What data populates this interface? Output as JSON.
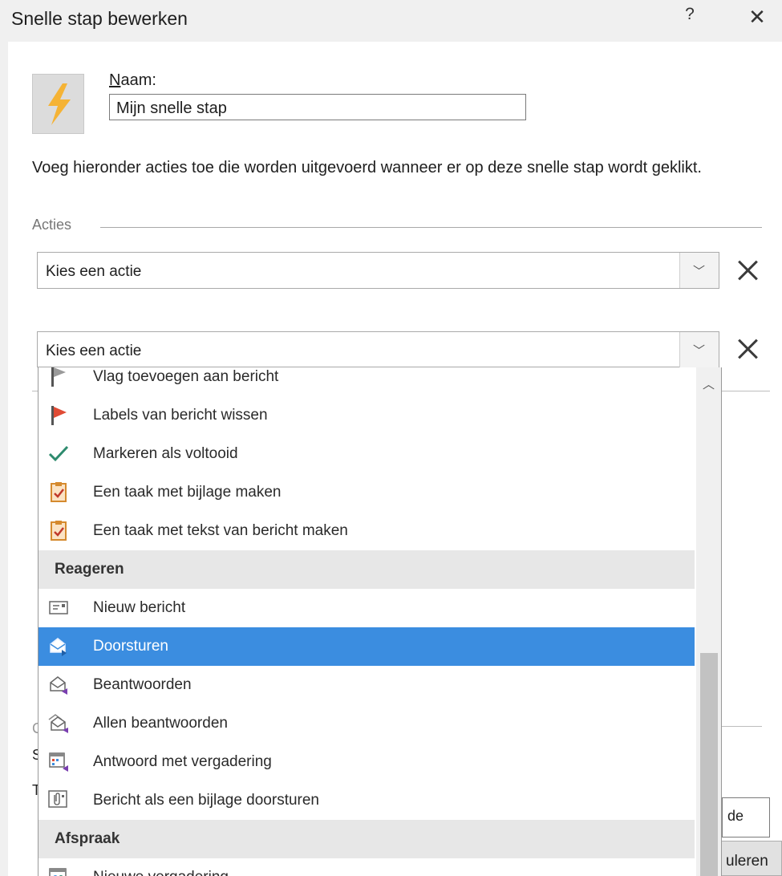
{
  "dialog": {
    "title": "Snelle stap bewerken",
    "help_glyph": "?",
    "close_glyph": "✕"
  },
  "name_field": {
    "label_accesskey": "N",
    "label_rest": "aam:",
    "value": "Mijn snelle stap"
  },
  "instruction": "Voeg hieronder acties toe die worden uitgevoerd wanneer er op deze snelle stap wordt geklikt.",
  "actions_section": {
    "label": "Acties",
    "combo1_value": "Kies een actie",
    "combo2_value": "Kies een actie"
  },
  "dropdown": {
    "items": [
      {
        "label": "Vlag toevoegen aan bericht",
        "icon": "flag-icon",
        "type": "item"
      },
      {
        "label": "Labels van bericht wissen",
        "icon": "red-flag-icon",
        "type": "item"
      },
      {
        "label": "Markeren als voltooid",
        "icon": "checkmark-icon",
        "type": "item"
      },
      {
        "label": "Een taak met bijlage maken",
        "icon": "task-clipboard-icon",
        "type": "item"
      },
      {
        "label": "Een taak met tekst van bericht maken",
        "icon": "task-clipboard-icon",
        "type": "item"
      },
      {
        "label": "Reageren",
        "type": "group"
      },
      {
        "label": "Nieuw bericht",
        "icon": "new-message-icon",
        "type": "item"
      },
      {
        "label": "Doorsturen",
        "icon": "forward-icon",
        "type": "item",
        "selected": true
      },
      {
        "label": "Beantwoorden",
        "icon": "reply-icon",
        "type": "item"
      },
      {
        "label": "Allen beantwoorden",
        "icon": "reply-all-icon",
        "type": "item"
      },
      {
        "label": "Antwoord met vergadering",
        "icon": "reply-meeting-icon",
        "type": "item"
      },
      {
        "label": "Bericht als een bijlage doorsturen",
        "icon": "forward-attachment-icon",
        "type": "item"
      },
      {
        "label": "Afspraak",
        "type": "group"
      },
      {
        "label": "Nieuwe vergadering",
        "icon": "new-meeting-icon",
        "type": "item"
      }
    ]
  },
  "background_fragments": {
    "textbox_fragment": "de",
    "button_fragment": "uleren",
    "frag_c": "C",
    "frag_s": "S",
    "frag_t": "T"
  },
  "colors": {
    "selection": "#3b8de0",
    "lightning": "#f5b335",
    "flag_red": "#e04b35",
    "check_green": "#2e8b6e",
    "reply_purple": "#7a3fb0"
  }
}
